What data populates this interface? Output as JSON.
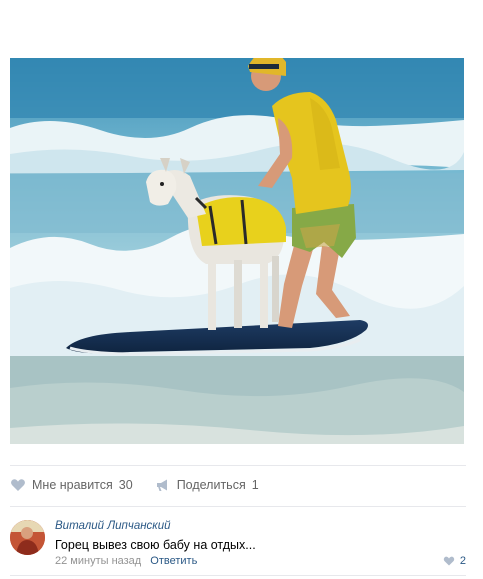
{
  "post": {
    "photo_alt": "photo",
    "like_label": "Мне нравится",
    "like_count": "30",
    "share_label": "Поделиться",
    "share_count": "1"
  },
  "comment": {
    "author": "Виталий Липчанский",
    "text": "Горец вывез свою бабу на отдых...",
    "time": "22 минуты назад",
    "reply_label": "Ответить",
    "like_count": "2"
  },
  "icons": {
    "like": "heart-icon",
    "share": "megaphone-icon",
    "comment_like": "heart-icon"
  },
  "colors": {
    "link": "#2a5885",
    "muted": "#939393",
    "icon": "#b0bccc"
  }
}
